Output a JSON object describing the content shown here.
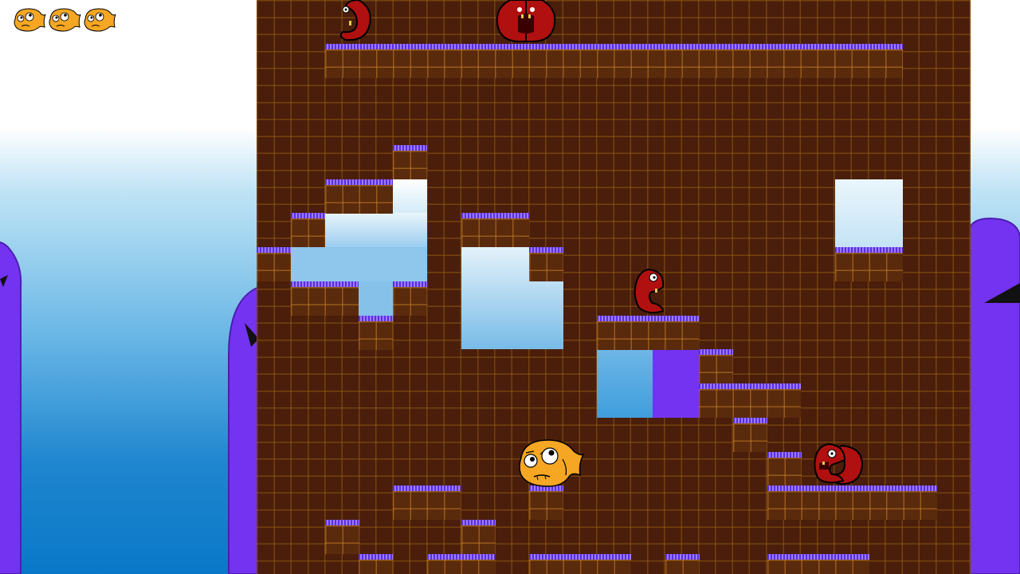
{
  "hud": {
    "lives": [
      {
        "icon": "player-face-icon"
      },
      {
        "icon": "player-face-icon"
      },
      {
        "icon": "player-face-icon"
      }
    ]
  },
  "colors": {
    "brick": "#4a1e0a",
    "platform_top": "#7a4ff2",
    "purple_wall": "#7433f0",
    "player": "#f5a623",
    "enemy": "#b01010",
    "sky_top": "#ffffff",
    "sky_bottom": "#0a78c8"
  },
  "entities": {
    "player": {
      "icon": "orange-blob-player-icon",
      "state": "worried"
    },
    "enemies": [
      {
        "icon": "red-worm-enemy-icon"
      },
      {
        "icon": "red-worm-pair-enemy-icon"
      },
      {
        "icon": "red-worm-enemy-icon"
      },
      {
        "icon": "red-worm-pair-enemy-icon"
      }
    ]
  }
}
